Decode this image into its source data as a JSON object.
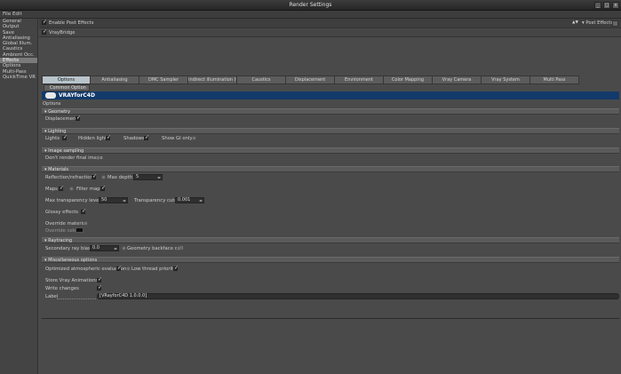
{
  "window": {
    "title": "Render Settings",
    "min": "_",
    "max": "□",
    "close": "x"
  },
  "menubar": {
    "label": "File Edit"
  },
  "sidebar": {
    "items": [
      {
        "label": "General",
        "active": false
      },
      {
        "label": "Output",
        "active": false
      },
      {
        "label": "Save",
        "active": false
      },
      {
        "label": "Antialiasing",
        "active": false
      },
      {
        "label": "Global Illum.",
        "active": false
      },
      {
        "label": "Caustics",
        "active": false
      },
      {
        "label": "Ambient Occ.",
        "active": false
      },
      {
        "label": "Effects",
        "active": true
      },
      {
        "label": "Options",
        "active": false
      },
      {
        "label": "Multi-Pass",
        "active": false
      },
      {
        "label": "QuickTime VR",
        "active": false
      }
    ]
  },
  "header": {
    "enable_post_effects": "Enable Post Effects",
    "post_effects_menu": "Post Effects",
    "post_effects_arrows": "▲▼",
    "bridge_item": "VrayBridge"
  },
  "tabs": [
    {
      "label": "Options",
      "active": true
    },
    {
      "label": "Antialiasing",
      "active": false
    },
    {
      "label": "DMC Sampler",
      "active": false
    },
    {
      "label": "Indirect illumination (GI)",
      "active": false
    },
    {
      "label": "Caustics",
      "active": false
    },
    {
      "label": "Displacement",
      "active": false
    },
    {
      "label": "Environment",
      "active": false
    },
    {
      "label": "Color Mapping",
      "active": false
    },
    {
      "label": "Vray Camera",
      "active": false
    },
    {
      "label": "Vray System",
      "active": false
    },
    {
      "label": "Multi Pass",
      "active": false
    }
  ],
  "subtab": {
    "label": "Common Option"
  },
  "banner": {
    "text": "VRAYforC4D"
  },
  "options_title": "Options",
  "sections": {
    "geometry": {
      "title": "Geometry",
      "displacement": "Displacement"
    },
    "lighting": {
      "title": "Lighting",
      "lights": "Lights",
      "hidden_lights": "Hidden lights",
      "shadows": "Shadows",
      "show_gi_only": "Show GI only"
    },
    "image_sampling": {
      "title": "Image sampling",
      "dont_render_final": "Don't render final image"
    },
    "materials": {
      "title": "Materials",
      "reflection_refraction": "Reflection/refraction",
      "max_depth_label": "Max depth",
      "max_depth_value": "5",
      "maps": "Maps",
      "filter_maps": "Filter maps",
      "max_transp_label": "Max transparency levels",
      "max_transp_value": "50",
      "transp_cutoff_label": "Transparency cutoff",
      "transp_cutoff_value": "0.001",
      "glossy_effects": "Glossy effects",
      "override_material": "Override material",
      "override_color": "Override color"
    },
    "raytracing": {
      "title": "Raytracing",
      "secondary_bias_label": "Secondary ray bias",
      "secondary_bias_value": "0.0",
      "geometry_backface_cull": "Geometry backface cull"
    },
    "miscellaneous": {
      "title": "Miscellaneous options",
      "optimized_atmospheric": "Optimized atmospheric evaluation",
      "low_thread_priority": "Low thread priority"
    },
    "bottom": {
      "store_vray_animations": "Store Vray Animations",
      "write_changes": "Write changes",
      "label_label": "Label",
      "label_value": "[VRayforC4D 1.0.0.0]"
    }
  }
}
